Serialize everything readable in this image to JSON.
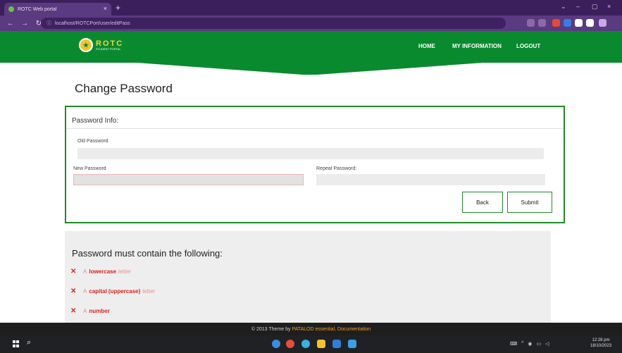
{
  "browser": {
    "tab_title": "ROTC Web portal",
    "tab_close": "×",
    "new_tab": "+",
    "url": "localhost/ROTCPort/user/editPass",
    "window_controls": {
      "minimize": "–",
      "maximize": "▢",
      "close": "×",
      "chevron": "⌄"
    }
  },
  "site": {
    "logo_title": "ROTC",
    "logo_subtitle": "STUDENT PORTAL",
    "nav": [
      "HOME",
      "MY INFORMATION",
      "LOGOUT"
    ],
    "header_color": "#0a8a2e"
  },
  "page": {
    "title": "Change Password",
    "card_title": "Password Info:",
    "fields": {
      "old_password": {
        "label": "Old Password",
        "value": ""
      },
      "new_password": {
        "label": "New Password",
        "value": ""
      },
      "repeat_password": {
        "label": "Repeat Password:",
        "value": ""
      }
    },
    "buttons": {
      "back": "Back",
      "submit": "Submit"
    }
  },
  "requirements": {
    "title": "Password must contain the following:",
    "items": [
      {
        "mark": "✕",
        "prefix": "A",
        "bold": "lowercase",
        "suffix": "letter"
      },
      {
        "mark": "✕",
        "prefix": "A",
        "bold": "capital (uppercase)",
        "suffix": "letter"
      },
      {
        "mark": "✕",
        "prefix": "A",
        "bold": "number",
        "suffix": ""
      }
    ]
  },
  "footer": {
    "text": "© 2013 Theme by",
    "link1": "PATALOD essential",
    "sep": ",",
    "link2": "Documentation"
  },
  "taskbar": {
    "clock_time": "12:28 pm",
    "clock_date": "18/10/2023",
    "icons": [
      "windows-icon",
      "search-icon",
      "chrome-icon",
      "chrome-profile-icon",
      "chrome-alt-icon",
      "file-explorer-icon",
      "vscode-icon",
      "store-icon"
    ]
  }
}
